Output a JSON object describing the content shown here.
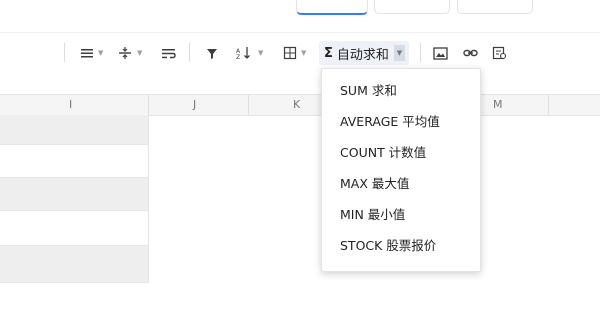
{
  "toolbar": {
    "autosum_label": "自动求和",
    "sigma": "Σ"
  },
  "columns": [
    {
      "label": "I"
    },
    {
      "label": "J"
    },
    {
      "label": "K"
    },
    {
      "label": "M"
    }
  ],
  "menu": {
    "items": [
      {
        "label": "SUM 求和"
      },
      {
        "label": "AVERAGE 平均值"
      },
      {
        "label": "COUNT 计数值"
      },
      {
        "label": "MAX 最大值"
      },
      {
        "label": "MIN 最小值"
      },
      {
        "label": "STOCK 股票报价"
      }
    ]
  }
}
